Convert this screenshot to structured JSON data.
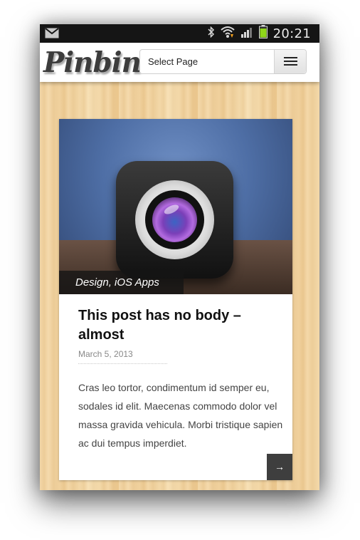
{
  "status_bar": {
    "time": "20:21",
    "icons": [
      "gmail-icon",
      "bluetooth-icon",
      "wifi-icon",
      "signal-icon",
      "battery-icon"
    ]
  },
  "header": {
    "logo_text": "Pinbin",
    "select_label": "Select Page",
    "menu_icon": "hamburger-icon"
  },
  "post": {
    "categories": "Design, iOS Apps",
    "title": "This post has no body – almost",
    "date": "March 5, 2013",
    "excerpt": "Cras leo tortor, condimentum id semper eu, sodales id elit. Maecenas commodo dolor vel massa gravida vehicula. Morbi tristique sapien ac dui tempus imperdiet.",
    "read_more": "→"
  },
  "colors": {
    "status_bg": "#151515",
    "wood": "#f2d39f",
    "card_bg": "#ffffff",
    "tag_bg": "#141414",
    "read_more_bg": "#3e3e3e"
  }
}
